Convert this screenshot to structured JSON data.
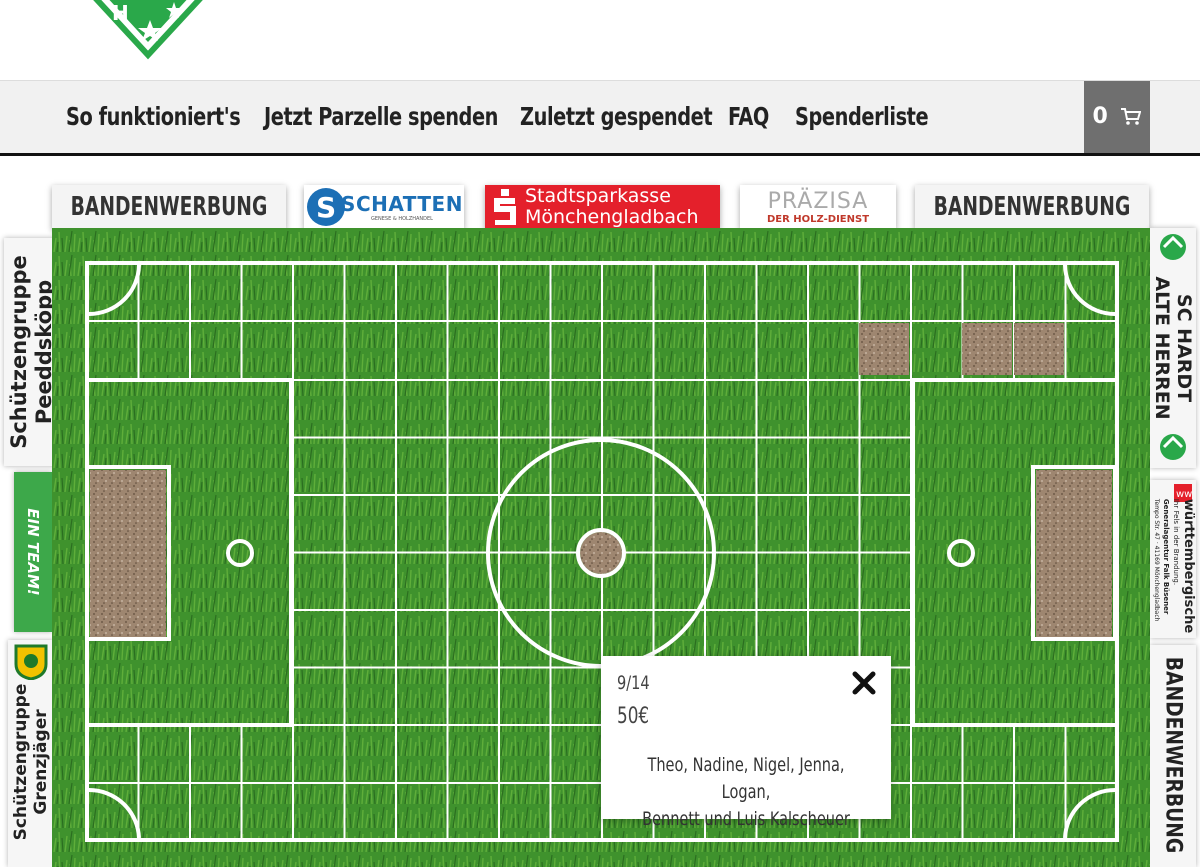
{
  "nav": {
    "items": [
      {
        "label": "So funktioniert's"
      },
      {
        "label": "Jetzt Parzelle spenden"
      },
      {
        "label": "Zuletzt gespendet"
      },
      {
        "label": "FAQ"
      },
      {
        "label": "Spenderliste"
      }
    ],
    "cart_count": "0",
    "cart_icon": "shopping-cart-icon"
  },
  "top_banners": {
    "left": "BANDENWERBUNG",
    "schatten": "SCHATTEN",
    "schatten_sub": "GENESE & HOLZHANDEL",
    "sparkasse_line1": "Stadtsparkasse",
    "sparkasse_line2": "Mönchengladbach",
    "praezisa": "PRÄZISA",
    "praezisa_sub": "DER HOLZ-DIENST",
    "right": "BANDENWERBUNG"
  },
  "left_banners": {
    "b1_line1": "Schützengruppe",
    "b1_line2": "Peeddsköpp",
    "b2": "EIN TEAM!",
    "b3_line1": "Schützengruppe",
    "b3_line2": "Grenzjäger"
  },
  "right_banners": {
    "b1_line1": "SC HARDT",
    "b1_line2": "ALTE HERREN",
    "b2_title": "württembergische",
    "b2_line1": "Ihr Fels in der Brandung.",
    "b2_line2": "Generalagentur Falk Büsener",
    "b2_line3": "Tempo Str. 47 · 41169 Mönchengladbach",
    "b3": "BANDENWERBUNG"
  },
  "popup": {
    "parcel": "9/14",
    "amount": "50€",
    "names_line1": "Theo, Nadine, Nigel, Jenna, Logan,",
    "names_line2": "Bennett und Luis Kalscheuer"
  },
  "colors": {
    "grass": "#3d8f2c",
    "line": "#ffffff",
    "sold": "#a08a74",
    "sparkasse": "#e4202b",
    "logo_green": "#2aa84a"
  }
}
